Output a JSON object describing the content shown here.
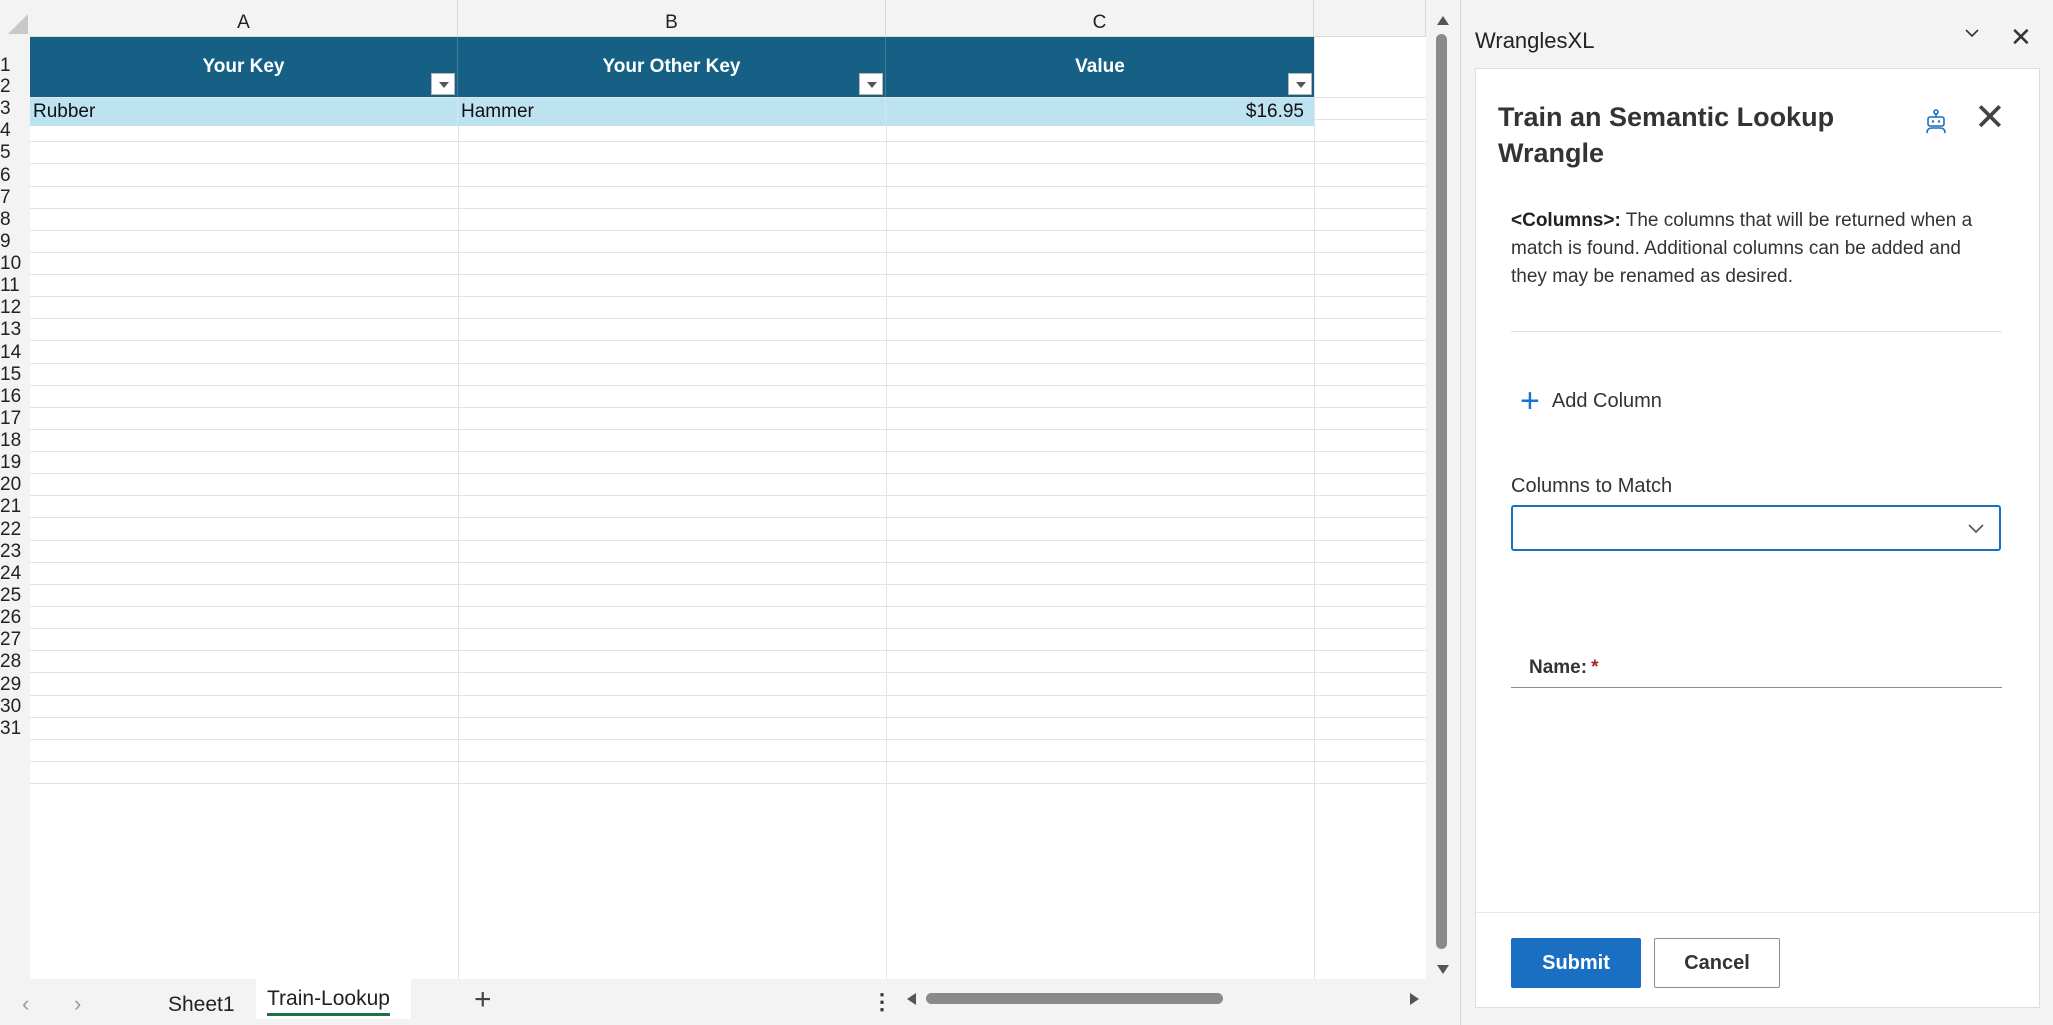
{
  "sheet": {
    "columns": [
      "A",
      "B",
      "C"
    ],
    "table": {
      "headers": [
        "Your Key",
        "Your Other Key",
        "Value"
      ],
      "rows": [
        [
          "Rubber",
          "Hammer",
          "$16.95"
        ]
      ]
    },
    "row_numbers": [
      "1",
      "2",
      "3",
      "4",
      "5",
      "6",
      "7",
      "8",
      "9",
      "10",
      "11",
      "12",
      "13",
      "14",
      "15",
      "16",
      "17",
      "18",
      "19",
      "20",
      "21",
      "22",
      "23",
      "24",
      "25",
      "26",
      "27",
      "28",
      "29",
      "30",
      "31"
    ],
    "tabs": [
      "Sheet1",
      "Train-Lookup"
    ],
    "active_tab": "Train-Lookup",
    "add_sheet_icon": "plus-icon",
    "header_color": "#176085",
    "row_highlight_color": "#bde3f1"
  },
  "pane": {
    "title": "WranglesXL",
    "heading": "Train an Semantic Lookup Wrangle",
    "description_bold": "<Columns>:",
    "description": " The columns that will be returned when a match is found. Additional columns can be added and they may be renamed as desired.",
    "add_column_label": "Add Column",
    "columns_to_match_label": "Columns to Match",
    "columns_to_match_value": "",
    "name_label": "Name:",
    "required_mark": "*",
    "submit_label": "Submit",
    "cancel_label": "Cancel",
    "accent_color": "#1a6fc2"
  }
}
